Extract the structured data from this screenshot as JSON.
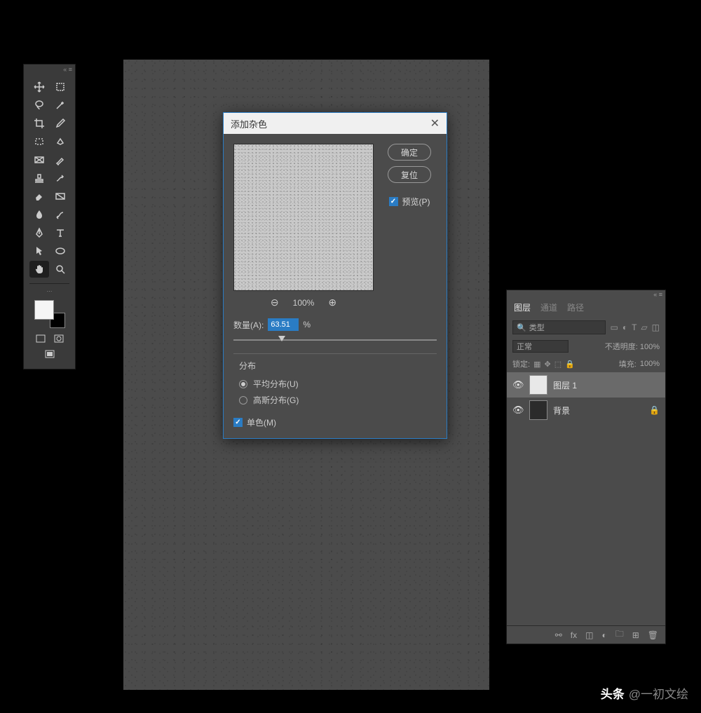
{
  "toolbox": {
    "icons": [
      "move",
      "artboard",
      "lasso",
      "wand",
      "crop",
      "eyedrop",
      "marquee",
      "heal",
      "frame",
      "brush",
      "stamp",
      "eraser",
      "eraser2",
      "gradient",
      "blur",
      "smudge",
      "pen",
      "type",
      "arrow",
      "ellipse",
      "hand",
      "zoom"
    ],
    "active_icon": "hand"
  },
  "dialog": {
    "title": "添加杂色",
    "ok": "确定",
    "reset": "复位",
    "preview_label": "预览(P)",
    "preview_checked": true,
    "zoom_pct": "100%",
    "amount_label": "数量(A):",
    "amount_value": "63.51",
    "amount_suffix": "%",
    "slider_pos_pct": 22,
    "dist_label": "分布",
    "dist_uniform": "平均分布(U)",
    "dist_gaussian": "高斯分布(G)",
    "dist_selected": "uniform",
    "mono_label": "单色(M)",
    "mono_checked": true
  },
  "layers_panel": {
    "tabs": [
      "图层",
      "通道",
      "路径"
    ],
    "active_tab": 0,
    "search_placeholder": "类型",
    "blend_mode": "正常",
    "opacity_label": "不透明度:",
    "opacity_value": "100%",
    "lock_label": "锁定:",
    "fill_label": "填充:",
    "fill_value": "100%",
    "layers": [
      {
        "name": "图层 1",
        "visible": true,
        "thumb": "white",
        "selected": true,
        "locked": false
      },
      {
        "name": "背景",
        "visible": true,
        "thumb": "dark",
        "selected": false,
        "locked": true
      }
    ],
    "footer_icons": [
      "link",
      "fx",
      "mask",
      "adjust",
      "group",
      "new",
      "trash"
    ]
  },
  "watermark": {
    "brand": "头条",
    "handle": "@一初文绘"
  }
}
